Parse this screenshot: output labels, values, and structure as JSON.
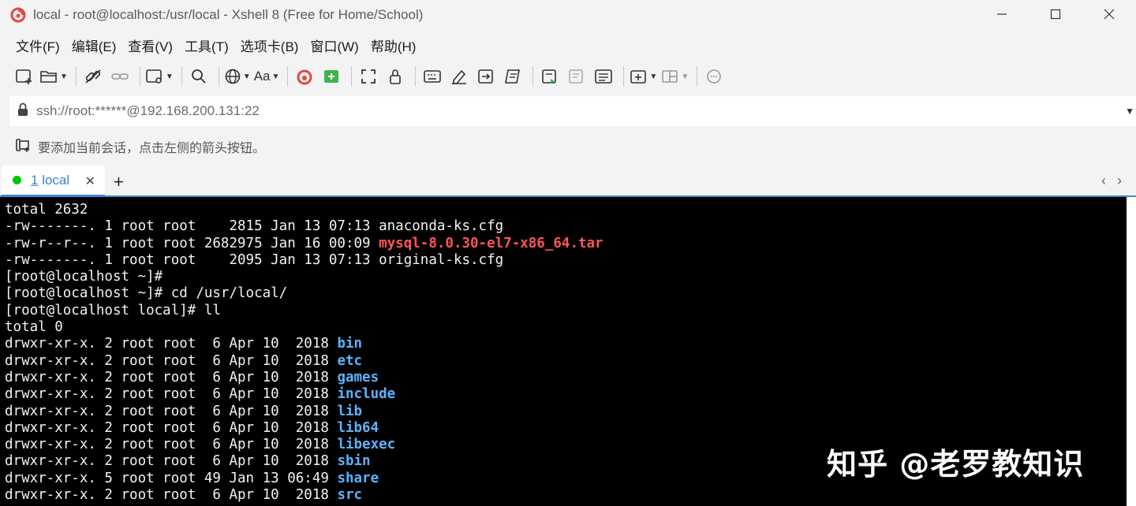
{
  "window": {
    "title": "local - root@localhost:/usr/local - Xshell 8 (Free for Home/School)",
    "minimize": "—",
    "maximize": "☐",
    "close": "✕"
  },
  "menu": [
    "文件(F)",
    "编辑(E)",
    "查看(V)",
    "工具(T)",
    "选项卡(B)",
    "窗口(W)",
    "帮助(H)"
  ],
  "toolbar": {
    "font_label": "Aa"
  },
  "address": {
    "url": "ssh://root:******@192.168.200.131:22"
  },
  "hint": {
    "text": "要添加当前会话，点击左侧的箭头按钮。"
  },
  "tabs": [
    {
      "number": "1",
      "label": "local",
      "status_color": "#00c800"
    }
  ],
  "tabbar": {
    "add": "+",
    "prev": "‹",
    "next": "›"
  },
  "terminal": {
    "lines": [
      [
        {
          "t": "total 2632",
          "c": "n"
        }
      ],
      [
        {
          "t": "-rw-------. 1 root root    2815 Jan 13 07:13 anaconda-ks.cfg",
          "c": "n"
        }
      ],
      [
        {
          "t": "-rw-r--r--. 1 root root 2682975 Jan 16 00:09 ",
          "c": "n"
        },
        {
          "t": "mysql-8.0.30-el7-x86_64.tar",
          "c": "red"
        }
      ],
      [
        {
          "t": "-rw-------. 1 root root    2095 Jan 13 07:13 original-ks.cfg",
          "c": "n"
        }
      ],
      [
        {
          "t": "[root@localhost ~]#",
          "c": "n"
        }
      ],
      [
        {
          "t": "[root@localhost ~]# cd /usr/local/",
          "c": "n"
        }
      ],
      [
        {
          "t": "[root@localhost local]# ll",
          "c": "n"
        }
      ],
      [
        {
          "t": "total 0",
          "c": "n"
        }
      ],
      [
        {
          "t": "drwxr-xr-x. 2 root root  6 Apr 10  2018 ",
          "c": "n"
        },
        {
          "t": "bin",
          "c": "blue"
        }
      ],
      [
        {
          "t": "drwxr-xr-x. 2 root root  6 Apr 10  2018 ",
          "c": "n"
        },
        {
          "t": "etc",
          "c": "blue"
        }
      ],
      [
        {
          "t": "drwxr-xr-x. 2 root root  6 Apr 10  2018 ",
          "c": "n"
        },
        {
          "t": "games",
          "c": "blue"
        }
      ],
      [
        {
          "t": "drwxr-xr-x. 2 root root  6 Apr 10  2018 ",
          "c": "n"
        },
        {
          "t": "include",
          "c": "blue"
        }
      ],
      [
        {
          "t": "drwxr-xr-x. 2 root root  6 Apr 10  2018 ",
          "c": "n"
        },
        {
          "t": "lib",
          "c": "blue"
        }
      ],
      [
        {
          "t": "drwxr-xr-x. 2 root root  6 Apr 10  2018 ",
          "c": "n"
        },
        {
          "t": "lib64",
          "c": "blue"
        }
      ],
      [
        {
          "t": "drwxr-xr-x. 2 root root  6 Apr 10  2018 ",
          "c": "n"
        },
        {
          "t": "libexec",
          "c": "blue"
        }
      ],
      [
        {
          "t": "drwxr-xr-x. 2 root root  6 Apr 10  2018 ",
          "c": "n"
        },
        {
          "t": "sbin",
          "c": "blue"
        }
      ],
      [
        {
          "t": "drwxr-xr-x. 5 root root 49 Jan 13 06:49 ",
          "c": "n"
        },
        {
          "t": "share",
          "c": "blue"
        }
      ],
      [
        {
          "t": "drwxr-xr-x. 2 root root  6 Apr 10  2018 ",
          "c": "n"
        },
        {
          "t": "src",
          "c": "blue"
        }
      ]
    ]
  },
  "watermark": "知乎 @老罗教知识",
  "colors": {
    "accent": "#3a86d6",
    "terminal_bg": "#000000",
    "terminal_fg": "#f2f2f2",
    "file_red": "#ff5555",
    "dir_blue": "#5cb3ff"
  }
}
